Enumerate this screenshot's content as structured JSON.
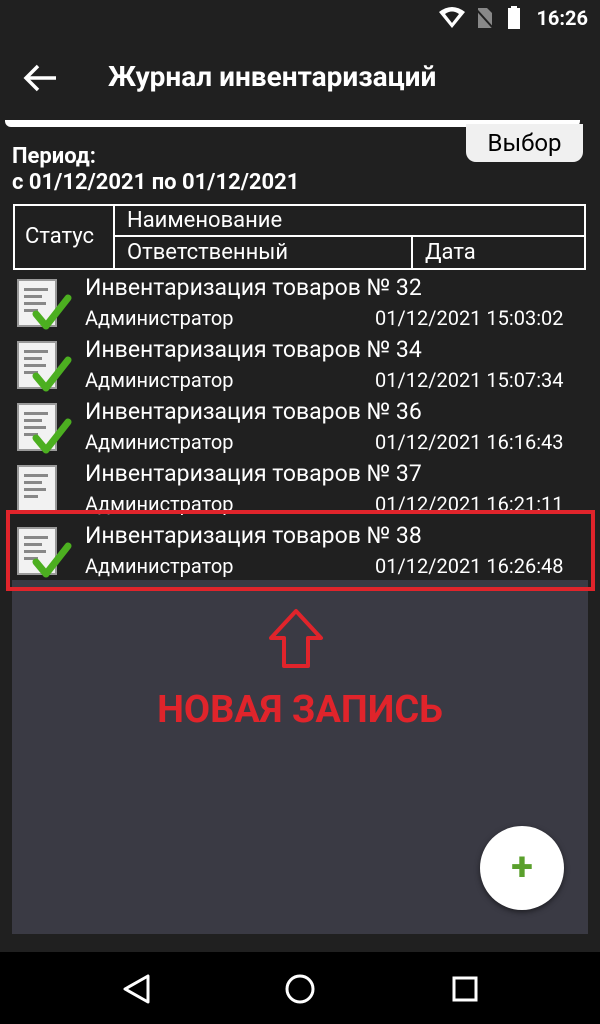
{
  "status_bar": {
    "time": "16:26"
  },
  "app_bar": {
    "title": "Журнал инвентаризаций"
  },
  "choose_button": {
    "label": "Выбор"
  },
  "period": {
    "label": "Период:",
    "range": "с 01/12/2021 по 01/12/2021"
  },
  "table_header": {
    "status": "Статус",
    "name": "Наименование",
    "responsible": "Ответственный",
    "date": "Дата"
  },
  "rows": [
    {
      "name": "Инвентаризация товаров № 32",
      "responsible": "Администратор",
      "date": "01/12/2021 15:03:02"
    },
    {
      "name": "Инвентаризация товаров № 34",
      "responsible": "Администратор",
      "date": "01/12/2021 15:07:34"
    },
    {
      "name": "Инвентаризация товаров № 36",
      "responsible": "Администратор",
      "date": "01/12/2021 16:16:43"
    },
    {
      "name": "Инвентаризация товаров № 37",
      "responsible": "Администратор",
      "date": "01/12/2021 16:21:11"
    },
    {
      "name": "Инвентаризация товаров № 38",
      "responsible": "Администратор",
      "date": "01/12/2021 16:26:48"
    }
  ],
  "annotation": {
    "label": "НОВАЯ ЗАПИСЬ",
    "color": "#e0242b"
  },
  "fab": {
    "label": "+"
  },
  "colors": {
    "accent_green": "#5aa02c",
    "list_bg": "#3a3a44",
    "highlight": "#e0242b"
  }
}
